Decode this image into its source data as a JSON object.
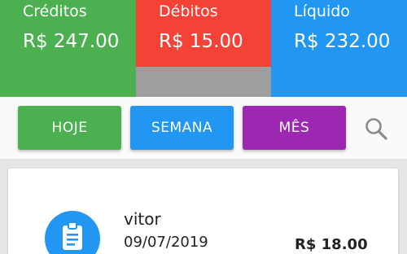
{
  "summary": {
    "credits": {
      "label": "Créditos",
      "value": "R$ 247.00"
    },
    "debits": {
      "label": "Débitos",
      "value": "R$ 15.00"
    },
    "net": {
      "label": "Líquido",
      "value": "R$ 232.00"
    }
  },
  "filters": {
    "today": "HOJE",
    "week": "SEMANA",
    "month": "MÊS"
  },
  "icons": {
    "search": "search-icon",
    "entry": "clipboard-icon"
  },
  "transactions": [
    {
      "name": "vitor",
      "date": "09/07/2019",
      "amount": "R$ 18.00"
    }
  ],
  "colors": {
    "credit": "#4caf50",
    "debit": "#f44336",
    "net": "#2196f3",
    "today": "#4caf50",
    "week": "#2196f3",
    "month": "#9c27b0"
  }
}
